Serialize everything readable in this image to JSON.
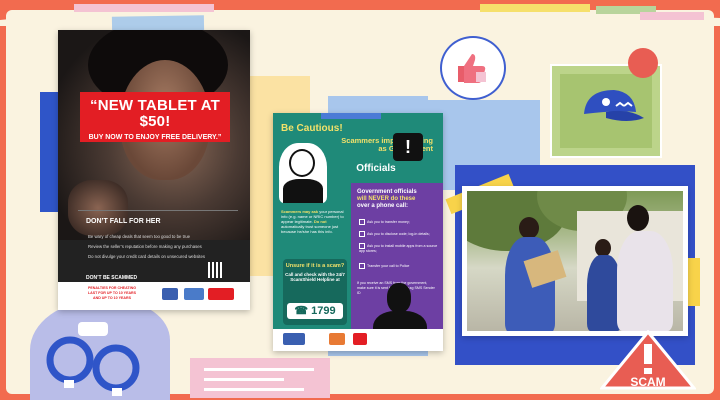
{
  "poster1": {
    "headline": "“NEW TABLET AT $50!",
    "subhead": "BUY NOW TO ENJOY FREE DELIVERY.”",
    "dont_fall_prefix": "DON’T FALL FOR HER",
    "dont_fall_suffix": "",
    "bullets": [
      "Be wary of cheap deals that seem too good to be true",
      "Review the seller’s reputation before making any purchases",
      "Do not divulge your credit card details on unsecured websites"
    ],
    "dont_be_scammed": "DON’T BE SCAMMED",
    "footer_text": "PENALTIES FOR CHEATING LAST FOR UP TO 10 YEARS AND UP TO 10 YEARS"
  },
  "poster2": {
    "title_line1": "Be Cautious!",
    "title_line2": "Scammers impersonating as Government",
    "title_line3": "Officials",
    "never_heading_1": "Government officials",
    "never_heading_2": "will NEVER do these",
    "never_heading_3": "over a phone call:",
    "never_items": [
      "Ask you to transfer money;",
      "Ask you to disclose code; log-in details;",
      "Ask you to install mobile apps from a source app stores;",
      "Transfer your call to Police"
    ],
    "never_footer": "If you receive an SMS from the government, make sure it is sent from the gov.sg SMS Sender ID",
    "scammer_text_1": "Scammers may ask",
    "scammer_text_2": "your personal info (e.g. name or NRIC number) to appear legitimate.",
    "scammer_text_3": "Do not",
    "scammer_text_4": "automatically trust someone just because he/she has this info.",
    "unsure": "Unsure if it is a scam?",
    "call_text": "Call and check with the 24/7 ScamShield Helpline at",
    "helpline": "1799"
  },
  "stickers": {
    "scam_tag": "SCAM"
  },
  "colors": {
    "background": "#f26b4f",
    "paper": "#faf3e0",
    "poster_red": "#e31e24",
    "poster2_teal": "#1f8a79",
    "poster2_purple": "#6d3fa3",
    "accent_yellow": "#f2e16a",
    "blue": "#3350c7"
  },
  "icons": [
    "thumbs-up-icon",
    "police-cap-icon",
    "handcuffs-icon",
    "alert-icon",
    "phone-icon",
    "scam-warning-icon"
  ]
}
